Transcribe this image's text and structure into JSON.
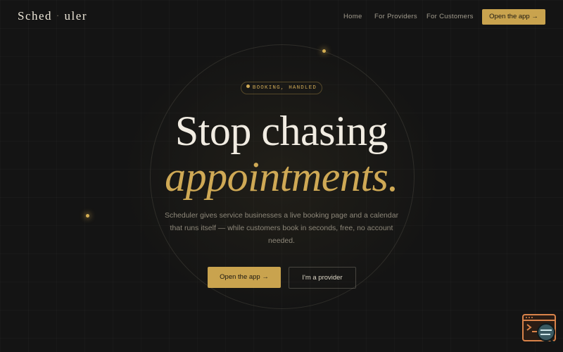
{
  "nav": {
    "logo_part1": "Sched",
    "logo_sep": "·",
    "logo_part2": "uler",
    "links": [
      "Home",
      "For Providers",
      "For Customers"
    ],
    "cta": "Open the app →"
  },
  "hero": {
    "badge": "BOOKING, HANDLED",
    "title_line1": "Stop chasing",
    "title_line2": "appointments.",
    "subtitle": "Scheduler gives service businesses a live booking page and a calendar that runs itself — while customers book in seconds, free, no account needed.",
    "primary_button": "Open the app →",
    "secondary_button": "I'm a provider"
  },
  "colors": {
    "background": "#141414",
    "accent": "#c9a34e",
    "text": "#f1ece2"
  },
  "icons": [
    "terminal-chat-widget-icon"
  ]
}
